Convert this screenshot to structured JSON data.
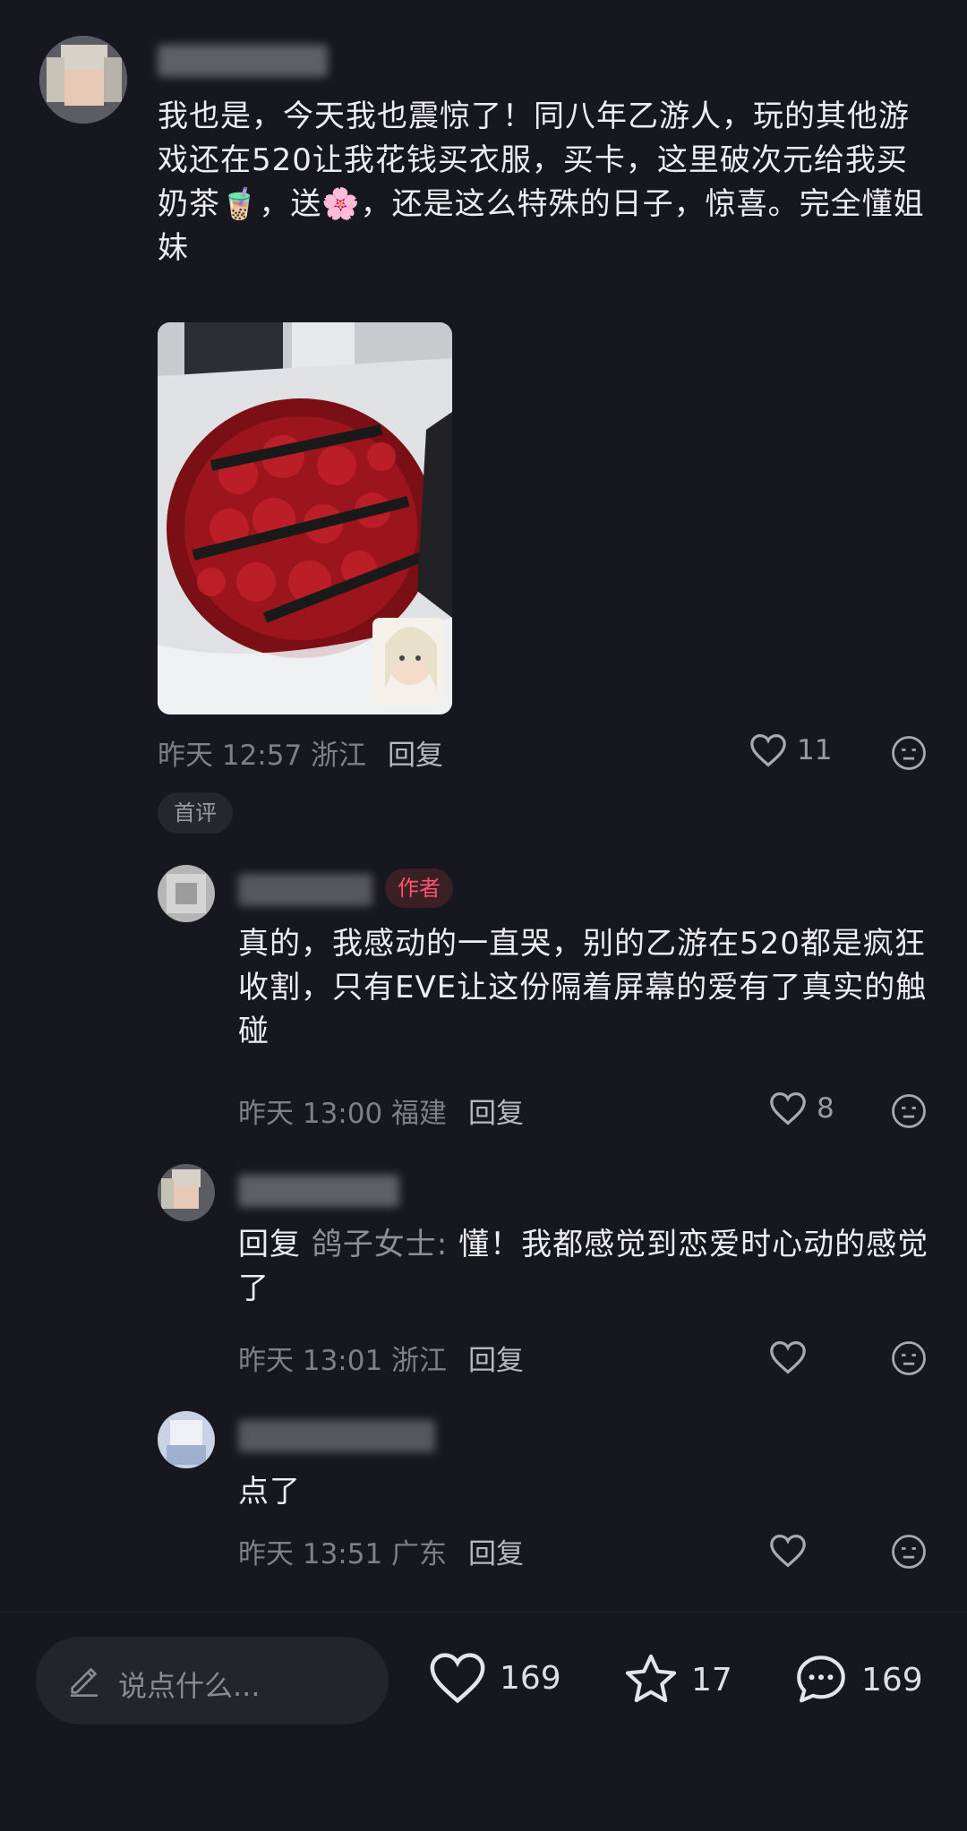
{
  "comments": [
    {
      "text": "我也是，今天我也震惊了！同八年乙游人，玩的其他游戏还在520让我花钱买衣服，买卡，这里破次元给我买奶茶🧋，送🌸，还是这么特殊的日子，惊喜。完全懂姐妹",
      "time": "昨天 12:57 浙江",
      "reply": "回复",
      "likes": "11",
      "tag": "首评"
    },
    {
      "badge": "作者",
      "text": "真的，我感动的一直哭，别的乙游在520都是疯狂收割，只有EVE让这份隔着屏幕的爱有了真实的触碰",
      "time": "昨天 13:00 福建",
      "reply": "回复",
      "likes": "8"
    },
    {
      "reply_prefix": "回复",
      "reply_target": "鸽子女士:",
      "text": "懂！我都感觉到恋爱时心动的感觉了",
      "time": "昨天 13:01 浙江",
      "reply": "回复"
    },
    {
      "text": "点了",
      "time": "昨天 13:51 广东",
      "reply": "回复"
    }
  ],
  "bottom_bar": {
    "input_placeholder": "说点什么...",
    "likes": "169",
    "favorites": "17",
    "comments": "169"
  },
  "colors": {
    "background": "#17171f",
    "badge_text": "#ff5470",
    "muted": "#7f7f88"
  }
}
